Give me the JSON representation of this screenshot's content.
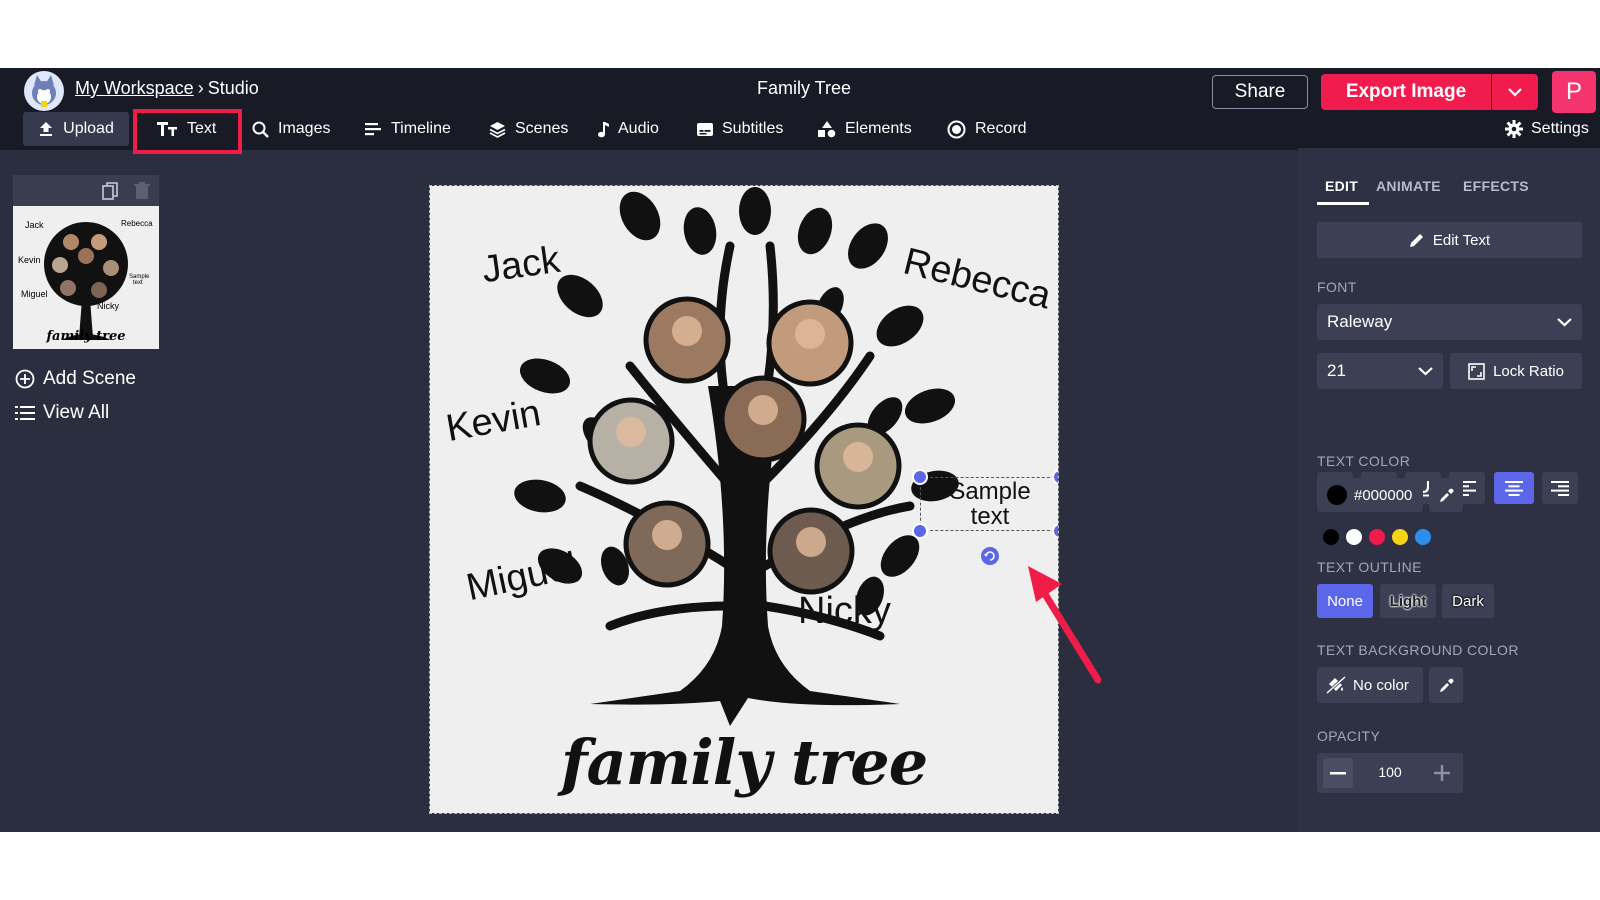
{
  "header": {
    "workspace_link": "My Workspace",
    "separator": "›",
    "studio": "Studio",
    "project_title": "Family Tree",
    "share_label": "Share",
    "export_label": "Export Image",
    "avatar_letter": "P"
  },
  "toolbar": {
    "items": [
      {
        "label": "Upload",
        "icon": "upload-icon"
      },
      {
        "label": "Text",
        "icon": "text-icon"
      },
      {
        "label": "Images",
        "icon": "search-icon"
      },
      {
        "label": "Timeline",
        "icon": "timeline-icon"
      },
      {
        "label": "Scenes",
        "icon": "layers-icon"
      },
      {
        "label": "Audio",
        "icon": "music-note-icon"
      },
      {
        "label": "Subtitles",
        "icon": "subtitles-icon"
      },
      {
        "label": "Elements",
        "icon": "shapes-icon"
      },
      {
        "label": "Record",
        "icon": "record-icon"
      }
    ],
    "settings_label": "Settings"
  },
  "sidebar": {
    "add_scene": "Add Scene",
    "view_all": "View All"
  },
  "canvas": {
    "names": [
      "Jack",
      "Rebecca",
      "Kevin",
      "Miguel",
      "Nicky"
    ],
    "selected_text_line1": "Sample",
    "selected_text_line2": "text",
    "title_art": "family tree"
  },
  "panel": {
    "tabs": [
      "EDIT",
      "ANIMATE",
      "EFFECTS"
    ],
    "active_tab": "EDIT",
    "edit_text": "Edit Text",
    "font_label": "FONT",
    "font_value": "Raleway",
    "size_value": "21",
    "lock_ratio": "Lock Ratio",
    "text_color_label": "TEXT COLOR",
    "text_color_value": "#000000",
    "swatches": [
      "#000000",
      "#ffffff",
      "#f21b4e",
      "#f7d515",
      "#2d8ef0"
    ],
    "text_outline_label": "TEXT OUTLINE",
    "outline_options": [
      "None",
      "Light",
      "Dark"
    ],
    "outline_selected": "None",
    "text_bg_label": "TEXT BACKGROUND COLOR",
    "text_bg_value": "No color",
    "opacity_label": "OPACITY",
    "opacity_value": "100"
  },
  "colors": {
    "accent": "#5b67e8",
    "brand_red": "#f21b4e",
    "app_bg": "#2b2e3f",
    "topbar_bg": "#181a26"
  }
}
